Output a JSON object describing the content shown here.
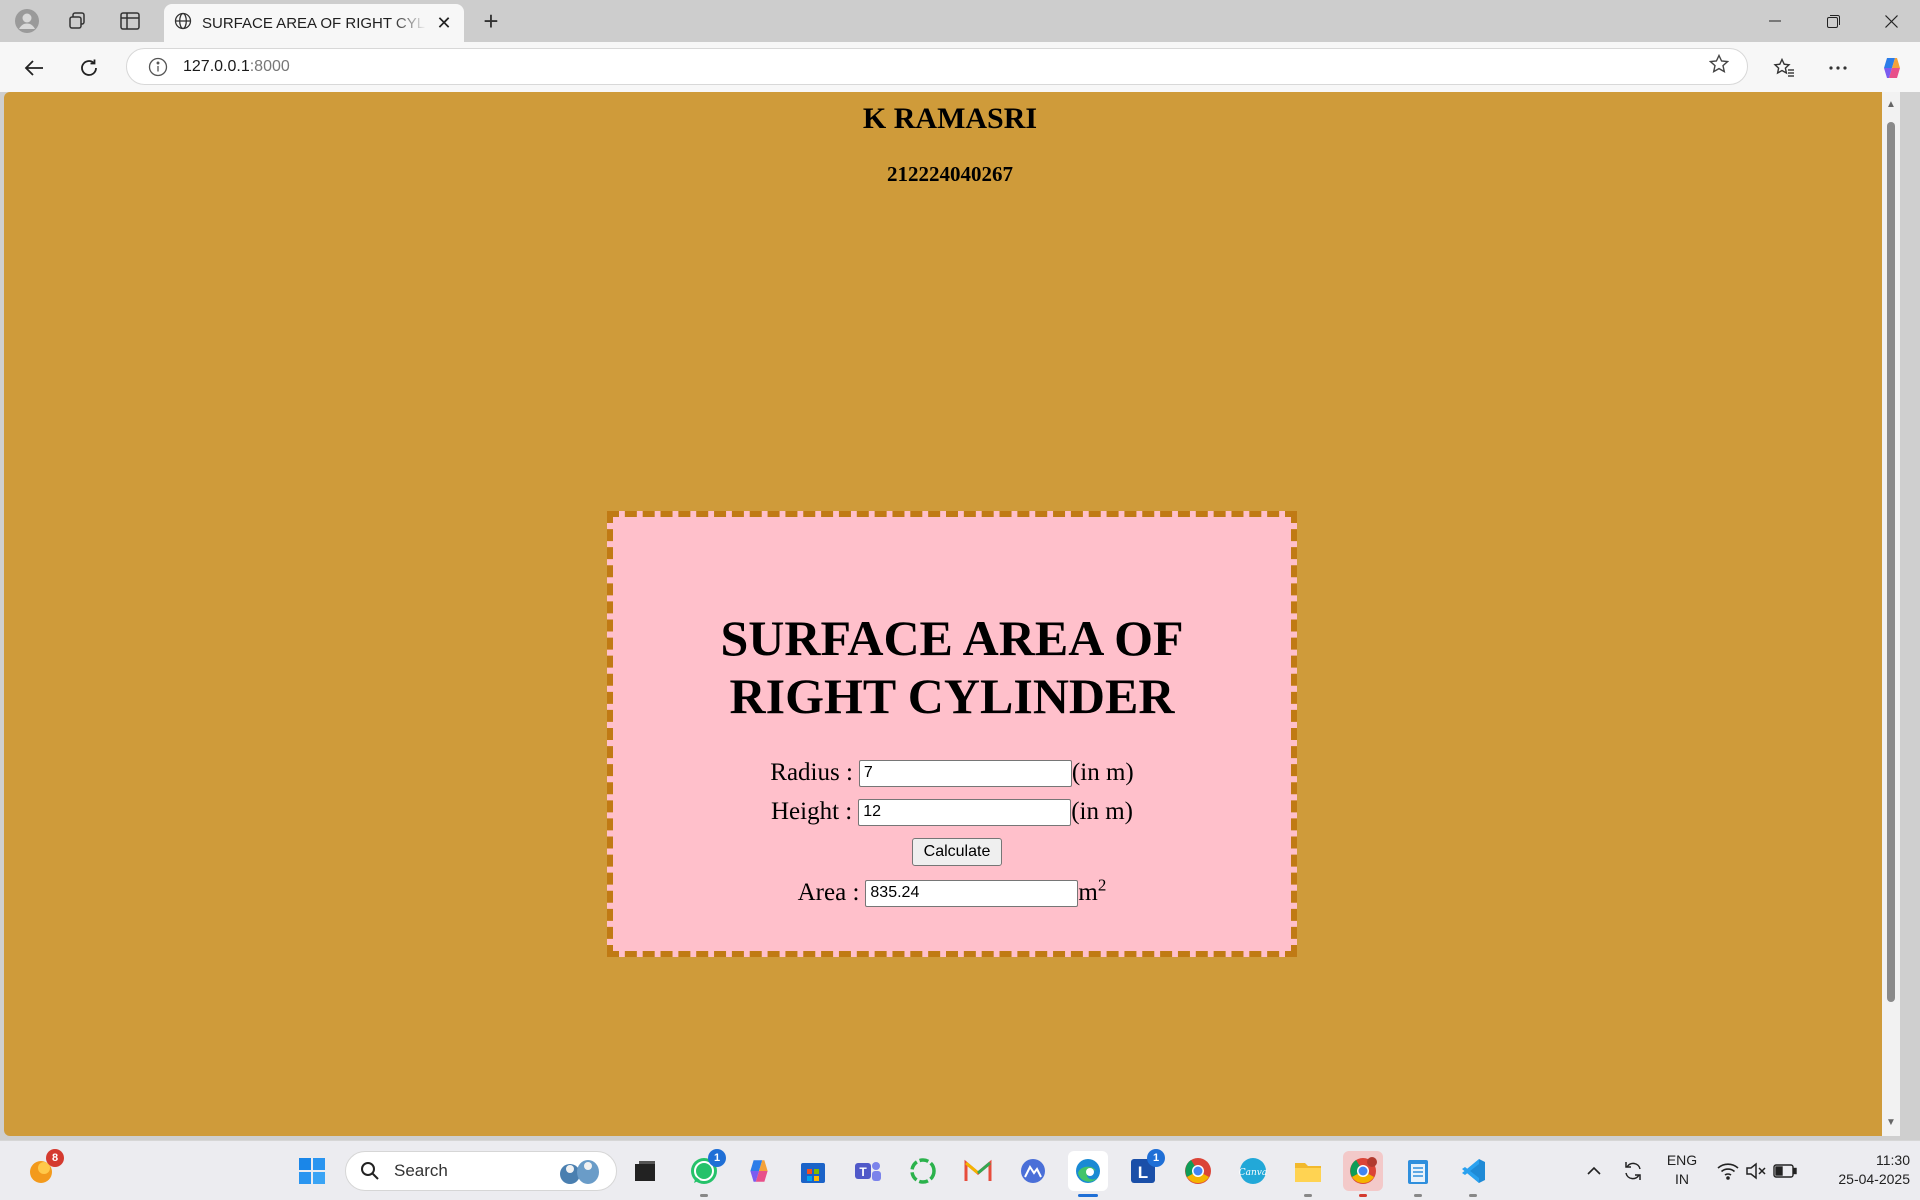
{
  "browser": {
    "tab_title": "SURFACE AREA OF RIGHT CYLINDER",
    "tab_close": "✕",
    "new_tab": "+",
    "url_host": "127.0.0.1",
    "url_port": ":8000"
  },
  "page": {
    "name": "K RAMASRI",
    "roll_number": "212224040267",
    "background_color": "#cf9b3a",
    "box_color": "#ffc0cb",
    "border_color": "#c07a14",
    "calculator": {
      "title_line1": "SURFACE AREA OF",
      "title_line2": "RIGHT CYLINDER",
      "radius_label": "Radius :",
      "radius_value": "7",
      "radius_unit": "(in m)",
      "height_label": "Height :",
      "height_value": "12",
      "height_unit": "(in m)",
      "button_label": "Calculate",
      "area_label": "Area :",
      "area_value": "835.24",
      "area_unit": "m",
      "area_unit_exp": "2"
    }
  },
  "taskbar": {
    "search_label": "Search",
    "weather_badge": "8",
    "whatsapp_badge": "1",
    "l_app_badge": "1",
    "language_line1": "ENG",
    "language_line2": "IN",
    "time": "11:30",
    "date": "25-04-2025",
    "apps": [
      "widgets",
      "start",
      "search",
      "task-view",
      "whatsapp",
      "copilot",
      "store",
      "teams",
      "circle-app",
      "gmail",
      "vpn-app",
      "edge",
      "l-app",
      "chrome",
      "canva",
      "file-explorer",
      "chrome-profile",
      "notepad",
      "vscode"
    ]
  }
}
